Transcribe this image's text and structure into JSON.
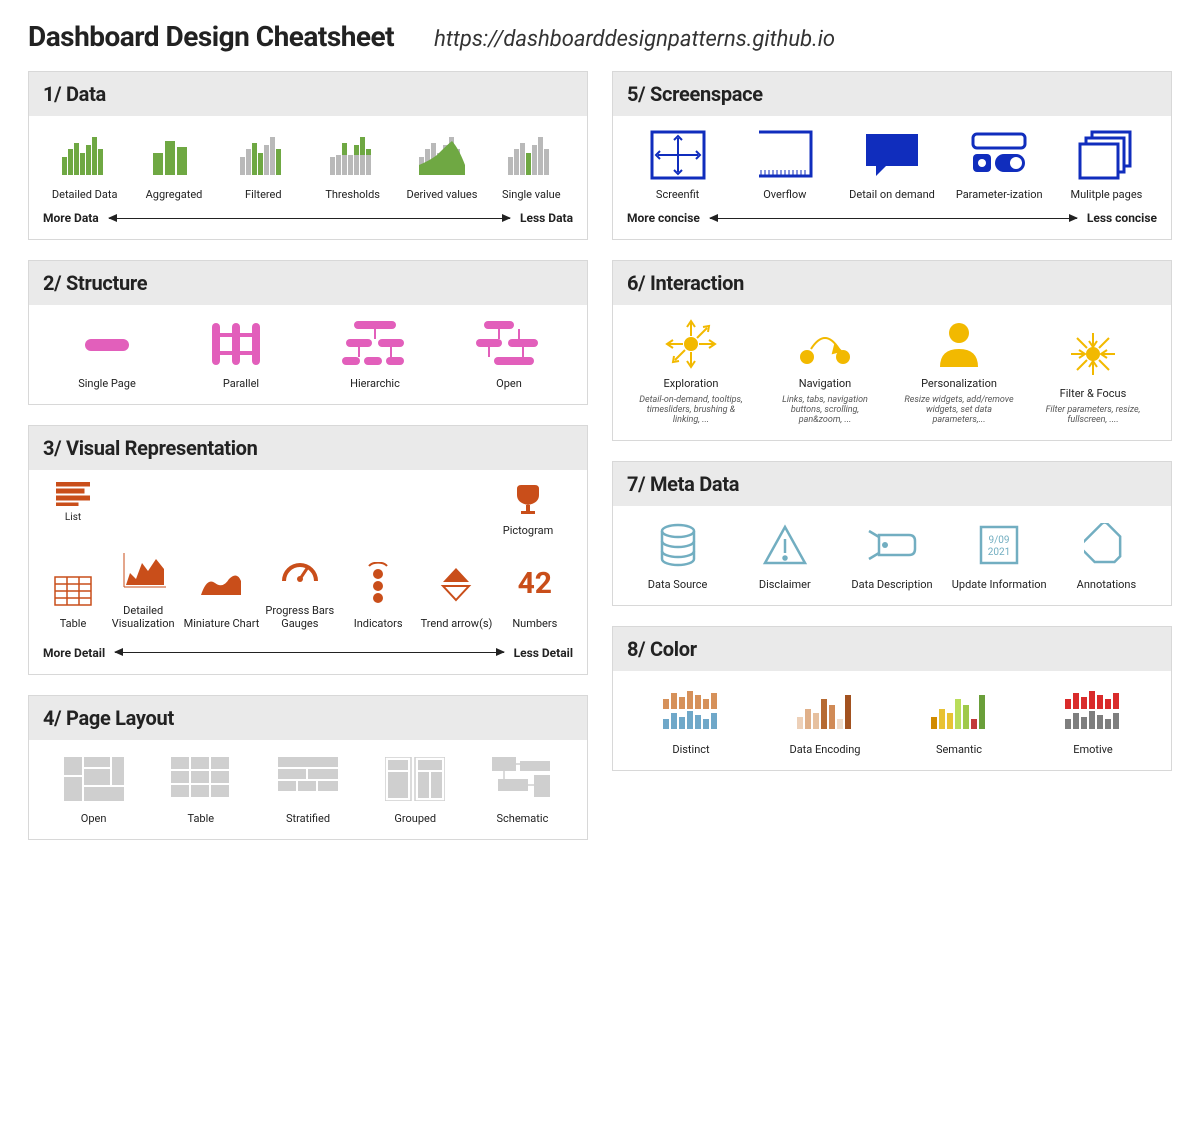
{
  "header": {
    "title": "Dashboard Design Cheatsheet",
    "url": "https://dashboarddesignpatterns.github.io"
  },
  "sections": {
    "data": {
      "title": "1/ Data",
      "scale_left": "More Data",
      "scale_right": "Less Data",
      "items": [
        {
          "label": "Detailed Data"
        },
        {
          "label": "Aggregated"
        },
        {
          "label": "Filtered"
        },
        {
          "label": "Thresholds"
        },
        {
          "label": "Derived values"
        },
        {
          "label": "Single value"
        }
      ]
    },
    "structure": {
      "title": "2/ Structure",
      "items": [
        {
          "label": "Single Page"
        },
        {
          "label": "Parallel"
        },
        {
          "label": "Hierarchic"
        },
        {
          "label": "Open"
        }
      ]
    },
    "visualrep": {
      "title": "3/ Visual Representation",
      "scale_left": "More Detail",
      "scale_right": "Less Detail",
      "list_label": "List",
      "table_label": "Table",
      "pictogram_label": "Pictogram",
      "numbers_value": "42",
      "items": [
        {
          "label": "Detailed Visualization"
        },
        {
          "label": "Miniature Chart"
        },
        {
          "label": "Progress Bars Gauges"
        },
        {
          "label": "Indicators"
        },
        {
          "label": "Trend arrow(s)"
        },
        {
          "label": "Numbers"
        }
      ]
    },
    "pagelayout": {
      "title": "4/ Page Layout",
      "items": [
        {
          "label": "Open"
        },
        {
          "label": "Table"
        },
        {
          "label": "Stratified"
        },
        {
          "label": "Grouped"
        },
        {
          "label": "Schematic"
        }
      ]
    },
    "screenspace": {
      "title": "5/ Screenspace",
      "scale_left": "More concise",
      "scale_right": "Less concise",
      "items": [
        {
          "label": "Screenfit"
        },
        {
          "label": "Overflow"
        },
        {
          "label": "Detail on demand"
        },
        {
          "label": "Parameter-ization"
        },
        {
          "label": "Mulitple pages"
        }
      ]
    },
    "interaction": {
      "title": "6/ Interaction",
      "items": [
        {
          "label": "Exploration",
          "sub": "Detail-on-demand, tooltips, timesliders, brushing & linking, ..."
        },
        {
          "label": "Navigation",
          "sub": "Links, tabs, navigation buttons, scrolling, pan&zoom, ..."
        },
        {
          "label": "Personalization",
          "sub": "Resize widgets, add/remove widgets, set data parameters,..."
        },
        {
          "label": "Filter & Focus",
          "sub": "Filter parameters, resize, fullscreen, ...."
        }
      ]
    },
    "metadata": {
      "title": "7/  Meta Data",
      "date_text": "9/09 2021",
      "items": [
        {
          "label": "Data Source"
        },
        {
          "label": "Disclaimer"
        },
        {
          "label": "Data Description"
        },
        {
          "label": "Update Information"
        },
        {
          "label": "Annotations"
        }
      ]
    },
    "color": {
      "title": "8/ Color",
      "items": [
        {
          "label": "Distinct"
        },
        {
          "label": "Data Encoding"
        },
        {
          "label": "Semantic"
        },
        {
          "label": "Emotive"
        }
      ]
    }
  }
}
